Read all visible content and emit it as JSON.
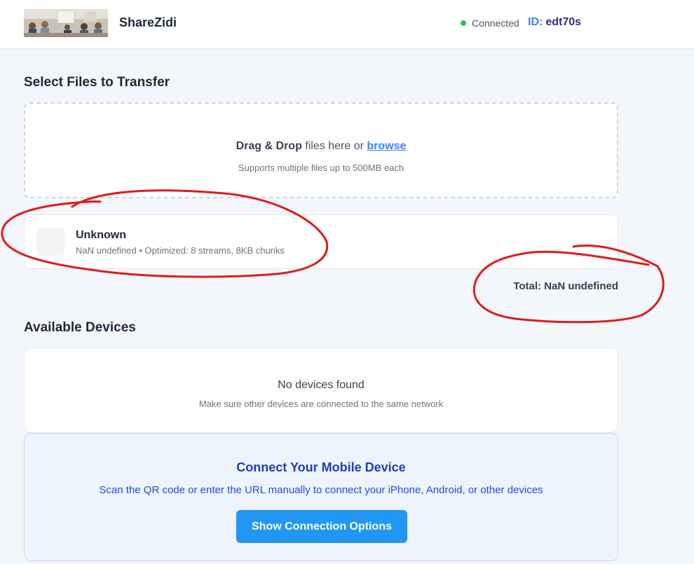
{
  "header": {
    "title": "ShareZidi",
    "status": "Connected",
    "id_label": "ID:",
    "id_value": "edt70s"
  },
  "files_section": {
    "title": "Select Files to Transfer",
    "drop_bold": "Drag & Drop",
    "drop_text": " files here or ",
    "browse": "browse",
    "drop_sub": "Supports multiple files up to 500MB each"
  },
  "file_item": {
    "name": "Unknown",
    "meta": "NaN undefined • Optimized: 8 streams, 8KB chunks"
  },
  "total": "Total: NaN undefined",
  "devices_section": {
    "title": "Available Devices",
    "empty_title": "No devices found",
    "empty_sub": "Make sure other devices are connected to the same network"
  },
  "mobile": {
    "title": "Connect Your Mobile Device",
    "subtitle": "Scan the QR code or enter the URL manually to connect your iPhone, Android, or other devices",
    "button": "Show Connection Options"
  },
  "colors": {
    "accent": "#2196f3",
    "status_dot": "#22c55e",
    "annotation": "#e01b1b"
  },
  "icons": [
    "logo-photo",
    "status-dot-icon",
    "file-thumbnail-icon"
  ]
}
